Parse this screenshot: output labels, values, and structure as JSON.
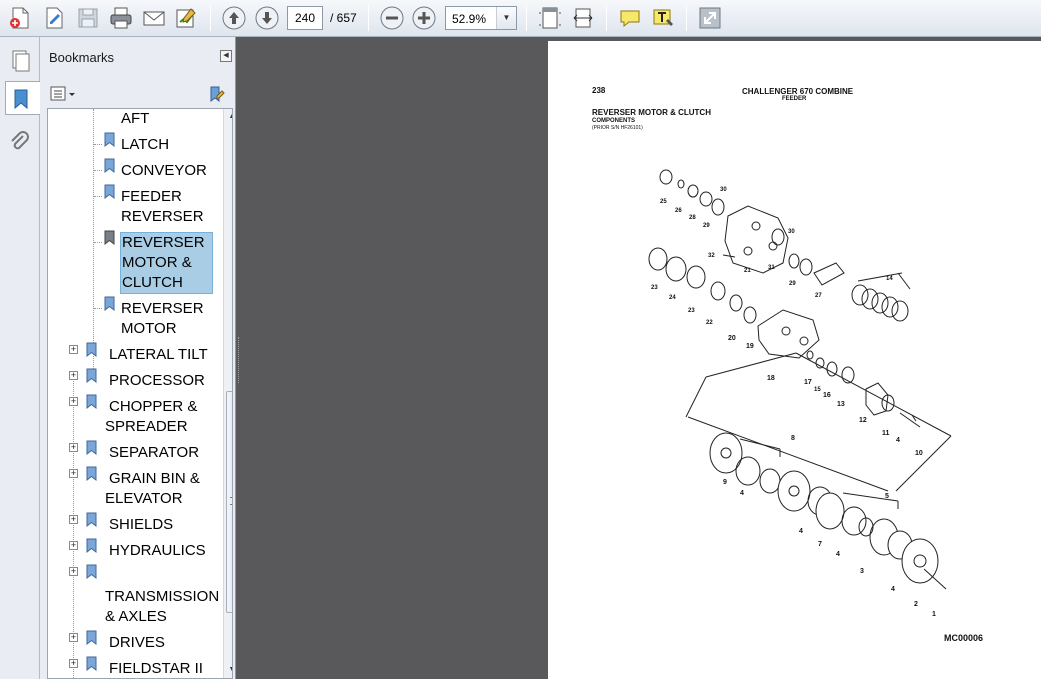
{
  "toolbar": {
    "buttons": [
      "create-icon",
      "edit-doc-icon",
      "save-icon",
      "print-icon",
      "email-icon",
      "sign-icon",
      "prev-page-icon",
      "next-page-icon",
      "zoom-out-icon",
      "zoom-in-icon",
      "fit-page-icon",
      "fit-width-icon",
      "comment-icon",
      "highlight-text-icon",
      "expand-icon"
    ],
    "page_number": "240",
    "page_total": "/ 657",
    "zoom": "52.9%"
  },
  "panel": {
    "title": "Bookmarks"
  },
  "bookmarks": {
    "items": [
      {
        "label": "AFT"
      },
      {
        "label": "LATCH"
      },
      {
        "label": "CONVEYOR"
      },
      {
        "label_line1": "FEEDER",
        "label_line2": "REVERSER"
      },
      {
        "label_line1": "REVERSER",
        "label_line2": "MOTOR &",
        "label_line3": "CLUTCH",
        "selected": true
      },
      {
        "label_line1": "REVERSER",
        "label_line2": "MOTOR"
      },
      {
        "label": "LATERAL TILT"
      },
      {
        "label": "PROCESSOR"
      },
      {
        "label_line1": "CHOPPER &",
        "label_line2": "SPREADER"
      },
      {
        "label": "SEPARATOR"
      },
      {
        "label_line1": "GRAIN BIN &",
        "label_line2": "ELEVATOR"
      },
      {
        "label": "SHIELDS"
      },
      {
        "label": "HYDRAULICS"
      },
      {
        "label_line1": "TRANSMISSION",
        "label_line2": "& AXLES"
      },
      {
        "label": "DRIVES"
      },
      {
        "label": "FIELDSTAR II"
      }
    ]
  },
  "document": {
    "page_num": "238",
    "header_title": "CHALLENGER 670 COMBINE",
    "header_sub": "FEEDER",
    "section_title": "REVERSER MOTOR & CLUTCH",
    "section_sub": "COMPONENTS",
    "section_note": "(PRIOR S/N HF26101)",
    "figure_id": "MC00006",
    "callouts": [
      "25",
      "26",
      "28",
      "30",
      "29",
      "30",
      "21",
      "32",
      "31",
      "29",
      "27",
      "14",
      "23",
      "24",
      "23",
      "22",
      "20",
      "19",
      "18",
      "17",
      "15",
      "16",
      "13",
      "12",
      "11",
      "4",
      "10",
      "8",
      "9",
      "4",
      "5",
      "4",
      "7",
      "4",
      "3",
      "4",
      "2",
      "1"
    ]
  },
  "colors": {
    "toolbar_bg": "#e3e9f1",
    "workspace_bg": "#59595b",
    "selection_bg": "#a9cde4",
    "panel_bg": "#e9edf3"
  }
}
